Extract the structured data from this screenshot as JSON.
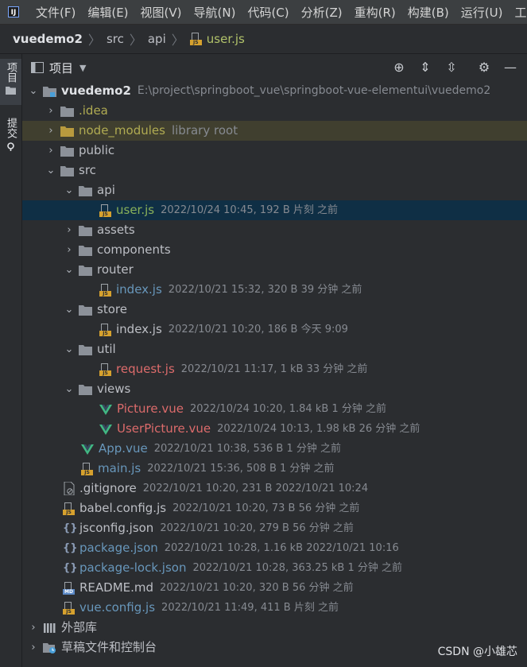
{
  "menu": [
    "文件(F)",
    "编辑(E)",
    "视图(V)",
    "导航(N)",
    "代码(C)",
    "分析(Z)",
    "重构(R)",
    "构建(B)",
    "运行(U)",
    "工具("
  ],
  "breadcrumb": {
    "project": "vuedemo2",
    "dir1": "src",
    "dir2": "api",
    "file": "user.js"
  },
  "side_tabs": {
    "project": "项目",
    "commit": "提交"
  },
  "panel": {
    "title": "项目"
  },
  "tree": [
    {
      "name": "vuedemo2",
      "meta": "E:\\project\\springboot_vue\\springboot-vue-elementui\\vuedemo2"
    },
    {
      "name": ".idea",
      "meta": ""
    },
    {
      "name": "node_modules",
      "meta": "library root"
    },
    {
      "name": "public",
      "meta": ""
    },
    {
      "name": "src",
      "meta": ""
    },
    {
      "name": "api",
      "meta": ""
    },
    {
      "name": "user.js",
      "meta": "2022/10/24 10:45, 192 B 片刻 之前"
    },
    {
      "name": "assets",
      "meta": ""
    },
    {
      "name": "components",
      "meta": ""
    },
    {
      "name": "router",
      "meta": ""
    },
    {
      "name": "index.js",
      "meta": "2022/10/21 15:32, 320 B 39 分钟 之前"
    },
    {
      "name": "store",
      "meta": ""
    },
    {
      "name": "index.js",
      "meta": "2022/10/21 10:20, 186 B 今天 9:09"
    },
    {
      "name": "util",
      "meta": ""
    },
    {
      "name": "request.js",
      "meta": "2022/10/21 11:17, 1 kB 33 分钟 之前"
    },
    {
      "name": "views",
      "meta": ""
    },
    {
      "name": "Picture.vue",
      "meta": "2022/10/24 10:20, 1.84 kB 1 分钟 之前"
    },
    {
      "name": "UserPicture.vue",
      "meta": "2022/10/24 10:13, 1.98 kB 26 分钟 之前"
    },
    {
      "name": "App.vue",
      "meta": "2022/10/21 10:38, 536 B 1 分钟 之前"
    },
    {
      "name": "main.js",
      "meta": "2022/10/21 15:36, 508 B 1 分钟 之前"
    },
    {
      "name": ".gitignore",
      "meta": "2022/10/21 10:20, 231 B 2022/10/21 10:24"
    },
    {
      "name": "babel.config.js",
      "meta": "2022/10/21 10:20, 73 B 56 分钟 之前"
    },
    {
      "name": "jsconfig.json",
      "meta": "2022/10/21 10:20, 279 B 56 分钟 之前"
    },
    {
      "name": "package.json",
      "meta": "2022/10/21 10:28, 1.16 kB 2022/10/21 10:16"
    },
    {
      "name": "package-lock.json",
      "meta": "2022/10/21 10:28, 363.25 kB 1 分钟 之前"
    },
    {
      "name": "README.md",
      "meta": "2022/10/21 10:20, 320 B 56 分钟 之前"
    },
    {
      "name": "vue.config.js",
      "meta": "2022/10/21 11:49, 411 B 片刻 之前"
    },
    {
      "name": "外部库",
      "meta": ""
    },
    {
      "name": "草稿文件和控制台",
      "meta": ""
    }
  ],
  "watermark": "CSDN @小雄芯",
  "colors": {
    "selected": "#0f2f45",
    "library": "#403f2f",
    "vue": "#41b883",
    "js": "#d6a12e"
  }
}
